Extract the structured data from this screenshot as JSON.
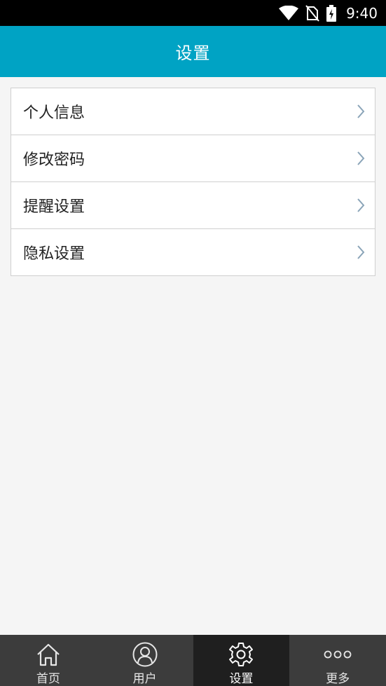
{
  "status_bar": {
    "time": "9:40",
    "icons": [
      "wifi-icon",
      "no-sim-icon",
      "battery-charging-icon"
    ]
  },
  "header": {
    "title": "设置"
  },
  "settings": {
    "items": [
      {
        "label": "个人信息",
        "icon": "chevron-right-icon"
      },
      {
        "label": "修改密码",
        "icon": "chevron-right-icon"
      },
      {
        "label": "提醒设置",
        "icon": "chevron-right-icon"
      },
      {
        "label": "隐私设置",
        "icon": "chevron-right-icon"
      }
    ]
  },
  "tab_bar": {
    "tabs": [
      {
        "label": "首页",
        "icon": "home-icon",
        "active": false
      },
      {
        "label": "用户",
        "icon": "user-icon",
        "active": false
      },
      {
        "label": "设置",
        "icon": "gear-icon",
        "active": true
      },
      {
        "label": "更多",
        "icon": "more-dots-icon",
        "active": false
      }
    ]
  },
  "colors": {
    "header_bg": "#00a3c4",
    "tab_bar_bg": "#3c3c3c",
    "tab_active_bg": "#1f1f1f",
    "page_bg": "#f5f5f5",
    "chevron": "#8aa4b8"
  }
}
